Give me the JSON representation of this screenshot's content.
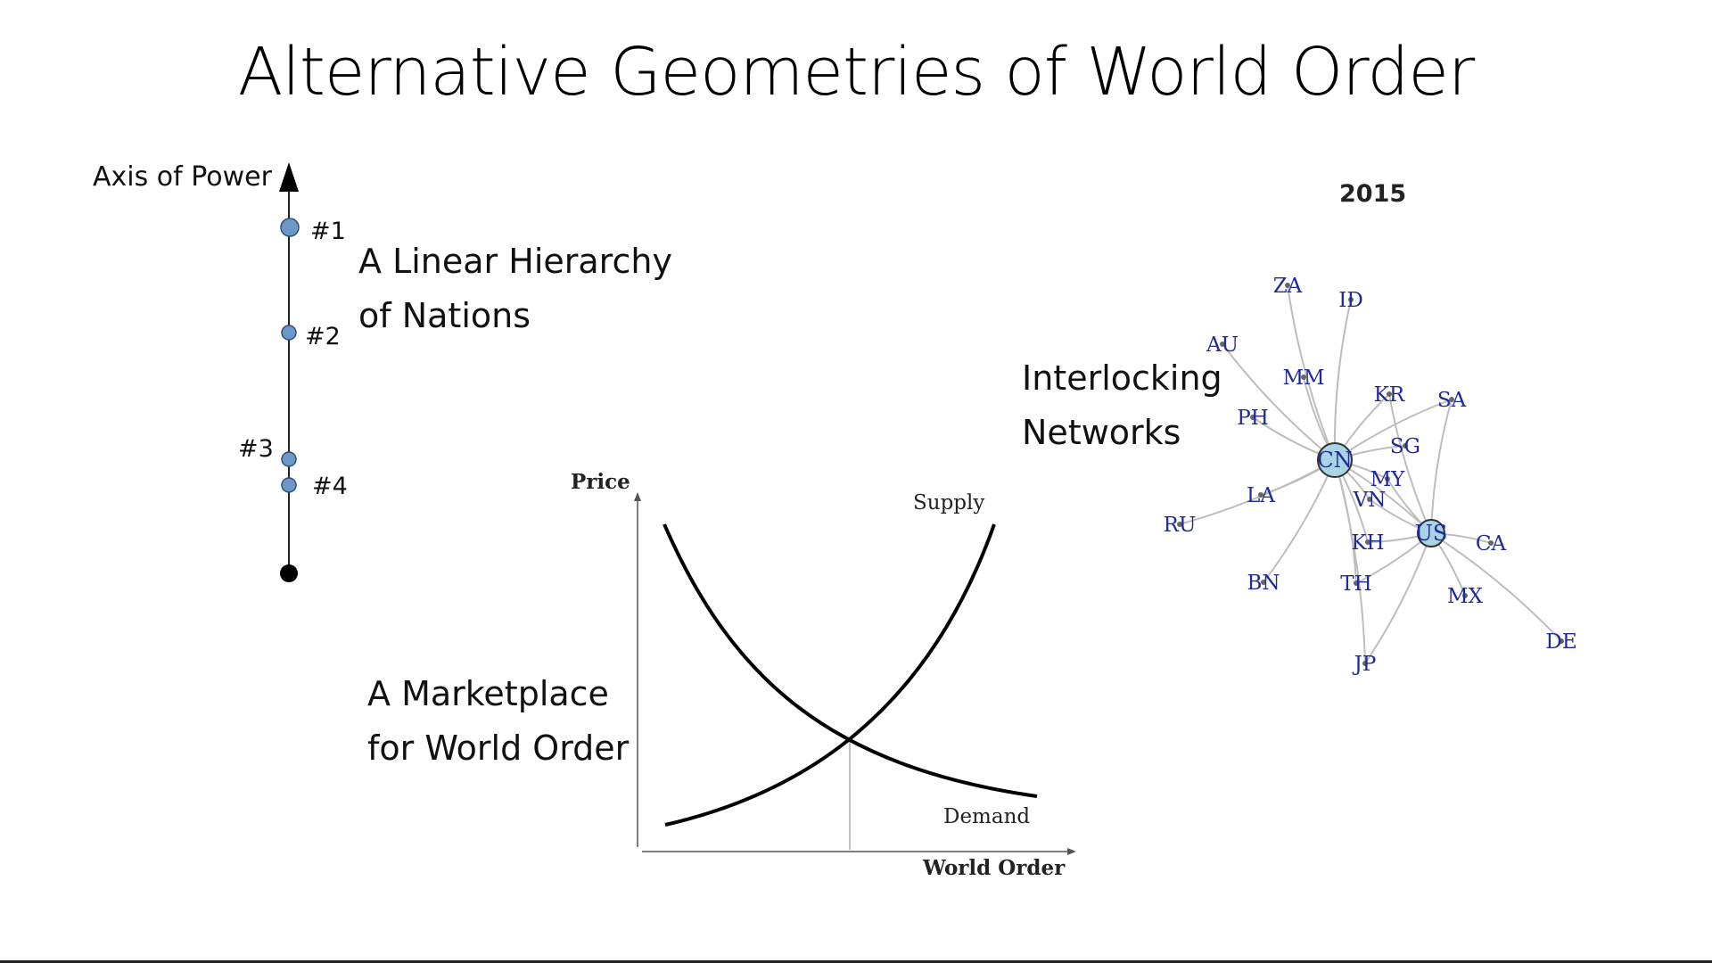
{
  "slide": {
    "title": "Alternative Geometries of World Order"
  },
  "hierarchy": {
    "axis_label": "Axis of Power",
    "ranks": [
      "#1",
      "#2",
      "#3",
      "#4"
    ],
    "caption_line1": "A Linear Hierarchy",
    "caption_line2": "of Nations",
    "node_color": "#6b97c9"
  },
  "market": {
    "caption_line1": "A Marketplace",
    "caption_line2": "for World Order",
    "y_label": "Price",
    "x_label": "World Order",
    "supply_label": "Supply",
    "demand_label": "Demand"
  },
  "network": {
    "caption_line1": "Interlocking",
    "caption_line2": "Networks",
    "year": "2015",
    "label_color": "#1f2a9c",
    "hub_fill": "#a9d4e6",
    "hubs": [
      "CN",
      "US"
    ],
    "nodes": [
      "ZA",
      "ID",
      "AU",
      "MM",
      "KR",
      "SA",
      "PH",
      "SG",
      "MY",
      "VN",
      "LA",
      "RU",
      "KH",
      "CA",
      "BN",
      "TH",
      "MX",
      "JP",
      "DE"
    ]
  }
}
